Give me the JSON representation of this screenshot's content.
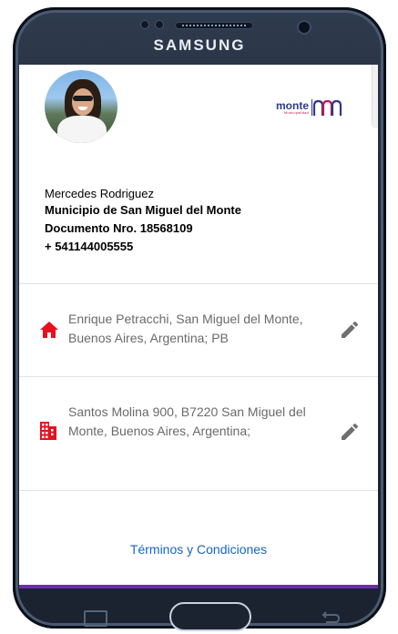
{
  "device": {
    "brand": "SAMSUNG"
  },
  "logo": {
    "word": "Monte",
    "sub": "Municipalidad",
    "colors": {
      "primary": "#2c3a8a",
      "accent": "#c2185b"
    }
  },
  "profile": {
    "name": "Mercedes Rodriguez",
    "municipality": "Municipio de San Miguel del Monte",
    "document": "Documento Nro. 18568109",
    "phone": "+ 541144005555"
  },
  "addresses": [
    {
      "icon": "home-icon",
      "text": "Enrique Petracchi, San Miguel del Monte, Buenos Aires, Argentina; PB"
    },
    {
      "icon": "building-icon",
      "text": "Santos Molina 900, B7220 San Miguel del Monte, Buenos Aires, Argentina;"
    }
  ],
  "terms": {
    "label": "Términos y Condiciones"
  },
  "colors": {
    "icon_red": "#e8101e",
    "link_blue": "#1565c0",
    "text_gray": "#6a6a6a",
    "bottom_bar": "#6a2fa8"
  }
}
